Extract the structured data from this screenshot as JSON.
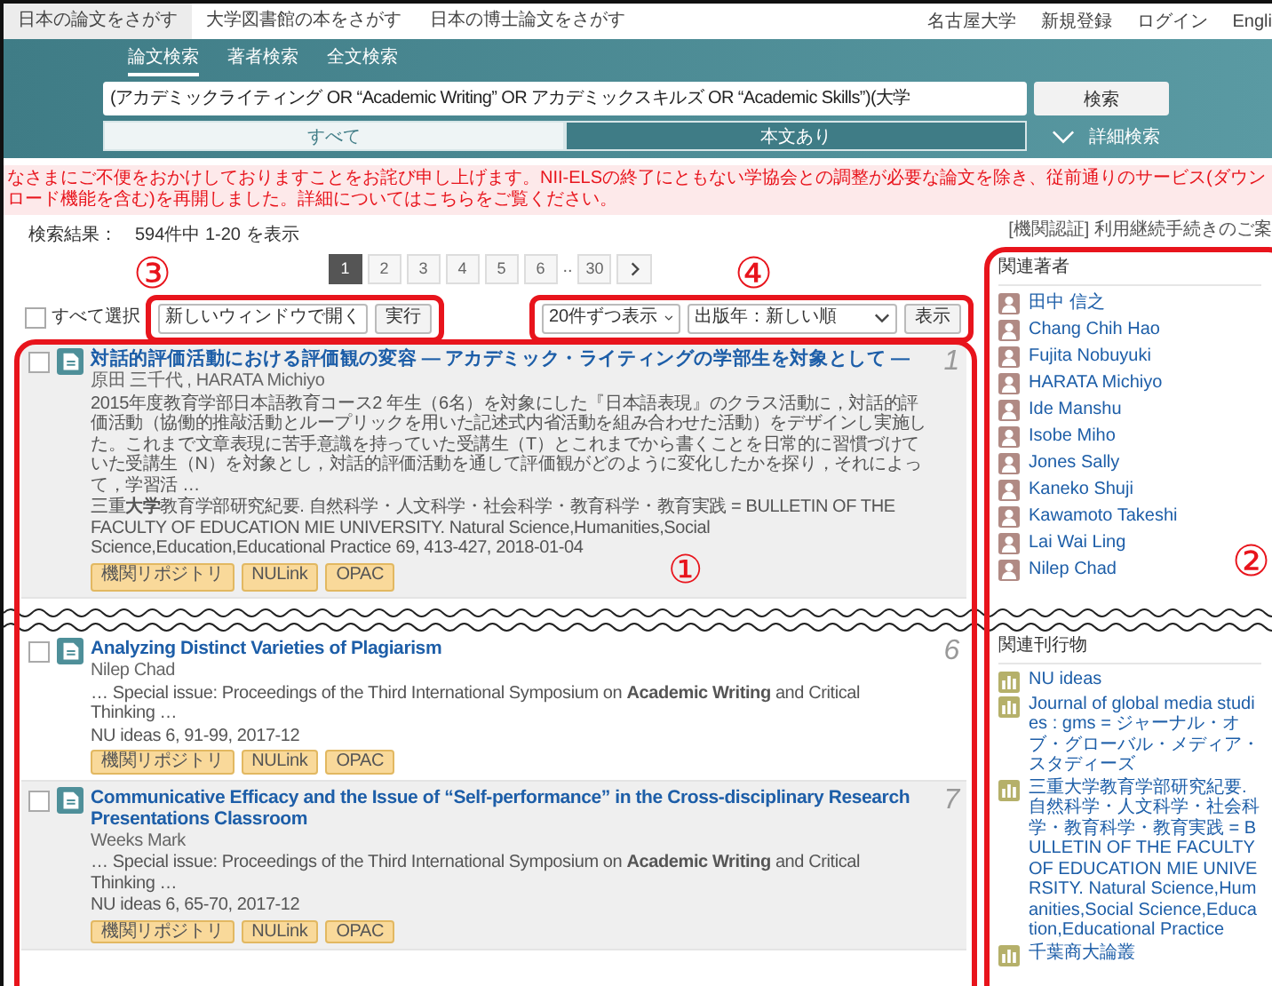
{
  "top_nav": {
    "tabs": [
      {
        "label": "日本の論文をさがす",
        "selected": true
      },
      {
        "label": "大学図書館の本をさがす",
        "selected": false
      },
      {
        "label": "日本の博士論文をさがす",
        "selected": false
      }
    ],
    "links": [
      "名古屋大学",
      "新規登録",
      "ログイン",
      "Engli"
    ]
  },
  "search": {
    "tabs": [
      {
        "label": "論文検索",
        "selected": true
      },
      {
        "label": "著者検索",
        "selected": false
      },
      {
        "label": "全文検索",
        "selected": false
      }
    ],
    "query": "(アカデミックライティング OR “Academic Writing” OR アカデミックスキルズ OR “Academic Skills”)(大学",
    "button": "検索",
    "filters": [
      {
        "label": "すべて",
        "selected": true
      },
      {
        "label": "本文あり",
        "selected": false
      }
    ],
    "advanced": "詳細検索"
  },
  "notice": "なさまにご不便をおかけしておりますことをお詫び申し上げます。NII-ELSの終了にともない学協会との調整が必要な論文を除き、従前通りのサービス(ダウンロード機能を含む)を再開しました。詳細についてはこちらをご覧ください。",
  "institution_link": "[機関認証] 利用継続手続きのご案",
  "result_count": {
    "label": "検索結果：",
    "value": "594件中 1-20 を表示"
  },
  "pagination": {
    "pages": [
      {
        "label": "1",
        "kind": "page",
        "selected": true
      },
      {
        "label": "2",
        "kind": "page",
        "selected": false
      },
      {
        "label": "3",
        "kind": "page",
        "selected": false
      },
      {
        "label": "4",
        "kind": "page",
        "selected": false
      },
      {
        "label": "5",
        "kind": "page",
        "selected": false
      },
      {
        "label": "6",
        "kind": "page",
        "selected": false
      },
      {
        "label": "..",
        "kind": "gap",
        "selected": false
      },
      {
        "label": "30",
        "kind": "page",
        "selected": false
      }
    ]
  },
  "bulk_actions": {
    "select_all": {
      "label": "すべて選択",
      "checked": false
    },
    "action": "新しいウィンドウで開く",
    "button": "実行"
  },
  "display_options": {
    "per_page": "20件ずつ表示",
    "sort": "出版年：新しい順",
    "button": "表示"
  },
  "results_before_break": [
    {
      "number": "1",
      "checked": false,
      "shaded": true,
      "title": "対話的評価活動における評価観の変容 ― アカデミック・ライティングの学部生を対象として ―",
      "authors": "原田 三千代 , HARATA Michiyo",
      "snippet": "2015年度教育学部日本語教育コース2 年生（6名）を対象にした『日本語表現』のクラス活動に，対話的評価活動（協働的推敲活動とループリックを用いた記述式内省活動を組み合わせた活動）をデザインし実施した。これまで文章表現に苦手意識を持っていた受講生（T）とこれまでから書くことを日常的に習慣づけていた受講生（N）を対象とし，対話的評価活動を通して評価観がどのように変化したかを探り，それによって，学習活 …",
      "source": "三重**大学**教育学部研究紀要. 自然科学・人文科学・社会科学・教育科学・教育実践 = BULLETIN OF THE FACULTY OF EDUCATION MIE UNIVERSITY. Natural Science,Humanities,Social Science,Education,Educational Practice 69, 413-427, 2018-01-04",
      "links": [
        "機関リポジトリ",
        "NULink",
        "OPAC"
      ]
    }
  ],
  "results_after_break": [
    {
      "number": "6",
      "checked": false,
      "shaded": false,
      "title": "Analyzing Distinct Varieties of Plagiarism",
      "authors": "Nilep Chad",
      "snippet": "… Special issue: Proceedings of the Third International Symposium on **Academic** **Writing** and Critical Thinking …",
      "source": "NU ideas 6, 91-99, 2017-12",
      "links": [
        "機関リポジトリ",
        "NULink",
        "OPAC"
      ]
    },
    {
      "number": "7",
      "checked": false,
      "shaded": true,
      "title": "Communicative Efficacy and the Issue of “Self-performance” in the Cross-disciplinary Research Presentations Classroom",
      "authors": "Weeks Mark",
      "snippet": "… Special issue: Proceedings of the Third International Symposium on **Academic** **Writing** and Critical Thinking …",
      "source": "NU ideas 6, 65-70, 2017-12",
      "links": [
        "機関リポジトリ",
        "NULink",
        "OPAC"
      ]
    }
  ],
  "related_authors": {
    "title": "関連著者",
    "items": [
      "田中 信之",
      "Chang Chih Hao",
      "Fujita Nobuyuki",
      "HARATA Michiyo",
      "Ide Manshu",
      "Isobe Miho",
      "Jones Sally",
      "Kaneko Shuji",
      "Kawamoto Takeshi",
      "Lai Wai Ling",
      "Nilep Chad"
    ]
  },
  "related_publications": {
    "title": "関連刊行物",
    "items": [
      "NU ideas",
      "Journal of global media studies : gms = ジャーナル・オブ・グローバル・メディア・スタディーズ",
      "三重大学教育学部研究紀要. 自然科学・人文科学・社会科学・教育科学・教育実践 = BULLETIN OF THE FACULTY OF EDUCATION MIE UNIVERSITY. Natural Science,Humanities,Social Science,Education,Educational Practice",
      "千葉商大論叢"
    ]
  },
  "annotations": [
    "①",
    "②",
    "③",
    "④"
  ]
}
